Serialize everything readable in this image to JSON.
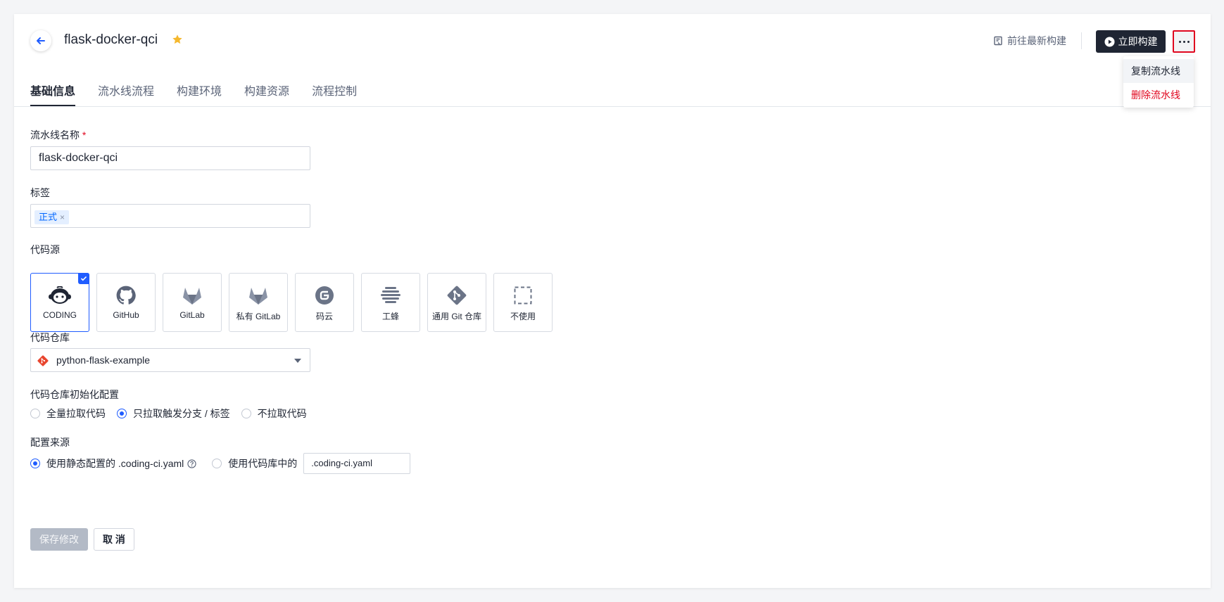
{
  "header": {
    "title": "flask-docker-qci",
    "goto_latest": "前往最新构建",
    "run_now": "立即构建"
  },
  "menu": {
    "copy": "复制流水线",
    "delete": "删除流水线"
  },
  "tabs": [
    {
      "label": "基础信息",
      "active": true
    },
    {
      "label": "流水线流程"
    },
    {
      "label": "构建环境"
    },
    {
      "label": "构建资源"
    },
    {
      "label": "流程控制"
    }
  ],
  "form": {
    "name_label": "流水线名称",
    "required_mark": "*",
    "name_value": "flask-docker-qci",
    "tags_label": "标签",
    "tag_chip": "正式",
    "tag_remove": "×",
    "source_label": "代码源",
    "sources": [
      {
        "label": "CODING",
        "icon": "coding-icon",
        "selected": true
      },
      {
        "label": "GitHub",
        "icon": "github-icon"
      },
      {
        "label": "GitLab",
        "icon": "gitlab-icon"
      },
      {
        "label": "私有 GitLab",
        "icon": "private-gitlab-icon"
      },
      {
        "label": "码云",
        "icon": "gitee-icon"
      },
      {
        "label": "工蜂",
        "icon": "gongfeng-icon"
      },
      {
        "label": "通用 Git 仓库",
        "icon": "git-icon"
      },
      {
        "label": "不使用",
        "icon": "none-icon"
      }
    ],
    "repo_label": "代码仓库",
    "repo_value": "python-flask-example",
    "init_label": "代码仓库初始化配置",
    "init_options": [
      {
        "label": "全量拉取代码",
        "selected": false
      },
      {
        "label": "只拉取触发分支 / 标签",
        "selected": true
      },
      {
        "label": "不拉取代码",
        "selected": false
      }
    ],
    "config_label": "配置来源",
    "config_static": "使用静态配置的 .coding-ci.yaml",
    "config_repo": "使用代码库中的",
    "config_repo_path": ".coding-ci.yaml",
    "save": "保存修改",
    "cancel": "取 消"
  },
  "colors": {
    "primary": "#1f5cff",
    "danger": "#e0071f",
    "dark": "#1f2533",
    "star": "#f5b82e"
  }
}
